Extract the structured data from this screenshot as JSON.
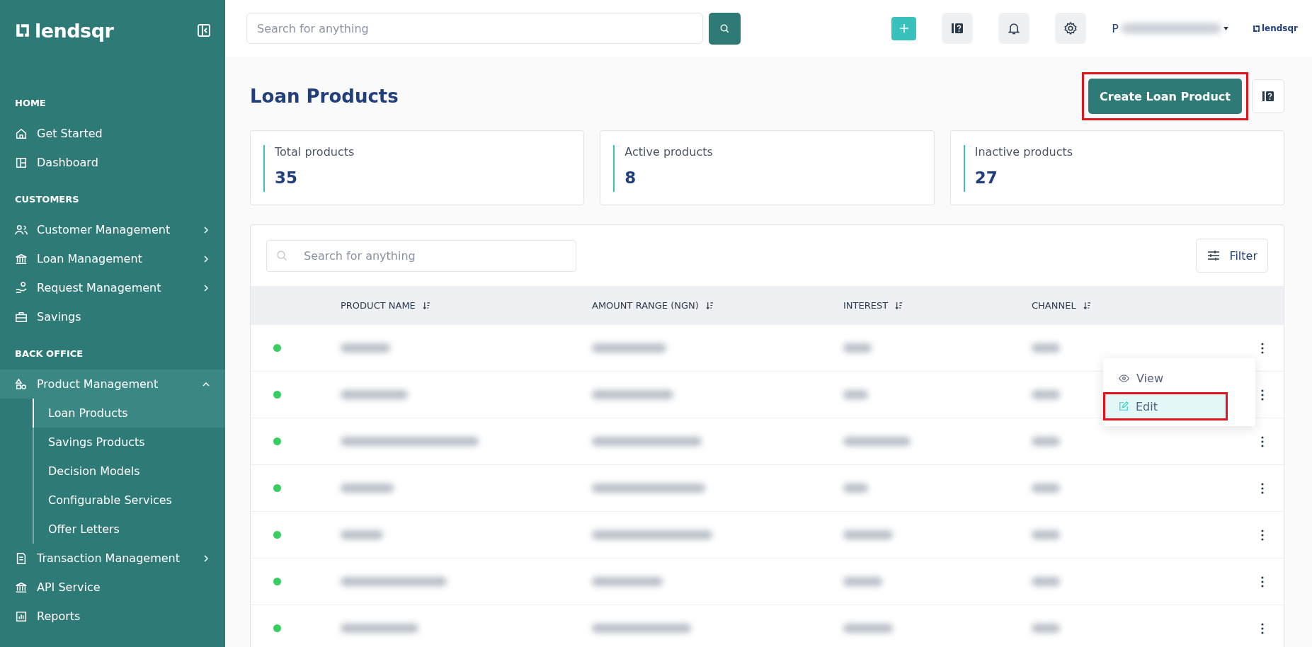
{
  "brand": {
    "name": "lendsqr"
  },
  "sidebar": {
    "sections": [
      {
        "title": "HOME",
        "items": [
          {
            "label": "Get Started",
            "has_arrow": false,
            "selected": false
          },
          {
            "label": "Dashboard",
            "has_arrow": false,
            "selected": false
          }
        ]
      },
      {
        "title": "CUSTOMERS",
        "items": [
          {
            "label": "Customer Management",
            "has_arrow": true,
            "selected": false
          },
          {
            "label": "Loan Management",
            "has_arrow": true,
            "selected": false
          },
          {
            "label": "Request Management",
            "has_arrow": true,
            "selected": false
          },
          {
            "label": "Savings",
            "has_arrow": false,
            "selected": false
          }
        ]
      },
      {
        "title": "BACK OFFICE",
        "items": [
          {
            "label": "Product Management",
            "has_arrow": true,
            "selected": true,
            "expanded": true,
            "children": [
              {
                "label": "Loan Products",
                "selected": true
              },
              {
                "label": "Savings Products",
                "selected": false
              },
              {
                "label": "Decision Models",
                "selected": false
              },
              {
                "label": "Configurable Services",
                "selected": false
              },
              {
                "label": "Offer Letters",
                "selected": false
              }
            ]
          },
          {
            "label": "Transaction Management",
            "has_arrow": true,
            "selected": false
          },
          {
            "label": "API Service",
            "has_arrow": false,
            "selected": false
          },
          {
            "label": "Reports",
            "has_arrow": false,
            "selected": false
          }
        ]
      }
    ]
  },
  "topbar": {
    "search": {
      "placeholder": "Search for anything"
    },
    "user_initial": "P",
    "partner_logo": "lendsqr"
  },
  "page": {
    "title": "Loan Products",
    "create_button": "Create Loan Product",
    "create_highlighted": true
  },
  "stats": [
    {
      "label": "Total products",
      "value": "35"
    },
    {
      "label": "Active products",
      "value": "8"
    },
    {
      "label": "Inactive products",
      "value": "27"
    }
  ],
  "table": {
    "search": {
      "placeholder": "Search for anything"
    },
    "filter_button": "Filter",
    "columns": [
      "PRODUCT NAME",
      "AMOUNT RANGE (NGN)",
      "INTEREST",
      "CHANNEL"
    ],
    "rows": [
      {
        "active": true,
        "menu": {
          "items": [
            {
              "label": "View",
              "kind": "view",
              "selected": false,
              "highlighted": false
            },
            {
              "label": "Edit",
              "kind": "edit",
              "selected": true,
              "highlighted": true
            }
          ]
        }
      },
      {
        "active": true
      },
      {
        "active": true
      },
      {
        "active": true
      },
      {
        "active": true
      },
      {
        "active": true
      },
      {
        "active": true
      }
    ]
  }
}
